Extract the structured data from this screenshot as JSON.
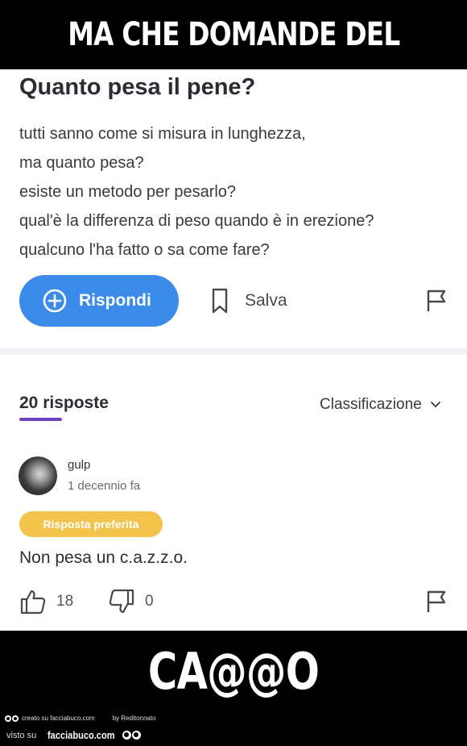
{
  "meme": {
    "top_caption": "MA CHE DOMANDE DEL",
    "bottom_caption": "CA@@O"
  },
  "question": {
    "title": "Quanto pesa il pene?",
    "body_lines": [
      "tutti sanno come si misura in lunghezza,",
      "ma quanto pesa?",
      "esiste un metodo per pesarlo?",
      "qual'è la differenza di peso quando è in erezione?",
      "qualcuno l'ha fatto o sa come fare?"
    ]
  },
  "actions": {
    "reply_label": "Rispondi",
    "save_label": "Salva"
  },
  "answers": {
    "count_label": "20 risposte",
    "sort_label": "Classificazione"
  },
  "answer": {
    "username": "gulp",
    "timestamp": "1 decennio fa",
    "badge": "Risposta preferita",
    "text": "Non pesa un c.a.z.z.o.",
    "likes": "18",
    "dislikes": "0"
  },
  "footer": {
    "created_on": "creato su facciabuco.com",
    "by": "by Reditonnato",
    "seen_on": "visto su",
    "site": "facciabuco.com"
  },
  "colors": {
    "reply_button": "#3b8be8",
    "badge": "#f3c44c",
    "underline_accent": "#6c3fc7"
  }
}
